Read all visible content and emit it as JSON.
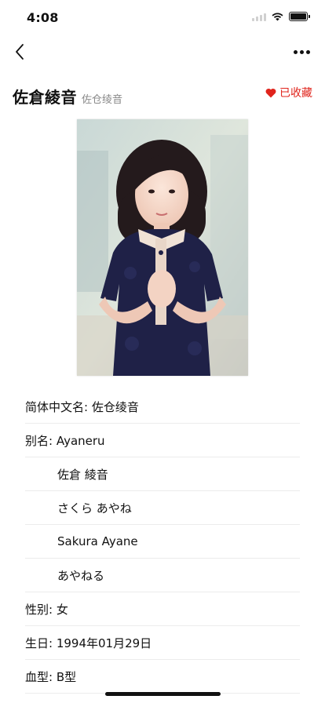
{
  "status": {
    "time": "4:08"
  },
  "header": {
    "name": "佐倉綾音",
    "name_sub": "佐仓绫音",
    "favorite_label": "已收藏",
    "favorite_color": "#e0241c"
  },
  "info": {
    "rows": [
      "简体中文名: 佐仓绫音",
      "别名: Ayaneru",
      "佐倉 綾音",
      "さくら あやね",
      "Sakura Ayane",
      "あやねる",
      "性别: 女",
      "生日: 1994年01月29日",
      "血型: B型"
    ]
  },
  "icons": {
    "back": "chevron-left-icon",
    "more": "more-horizontal-icon",
    "favorite": "heart-icon",
    "wifi": "wifi-icon",
    "battery": "battery-icon"
  }
}
